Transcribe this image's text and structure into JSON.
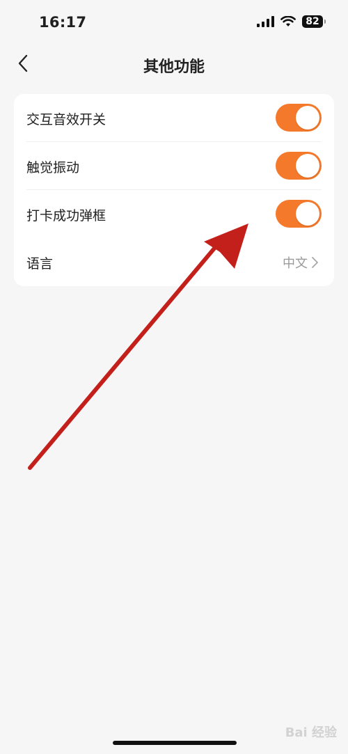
{
  "status_bar": {
    "time": "16:17",
    "battery": "82",
    "icons": [
      "signal-icon",
      "wifi-icon",
      "battery-icon"
    ]
  },
  "nav": {
    "title": "其他功能",
    "back_icon": "chevron-left-icon"
  },
  "settings": {
    "items": [
      {
        "label": "交互音效开关",
        "type": "toggle",
        "on": true
      },
      {
        "label": "触觉振动",
        "type": "toggle",
        "on": true
      },
      {
        "label": "打卡成功弹框",
        "type": "toggle",
        "on": true
      },
      {
        "label": "语言",
        "type": "link",
        "value": "中文"
      }
    ]
  },
  "colors": {
    "accent": "#f5792b",
    "background": "#f6f6f7",
    "card": "#ffffff",
    "annotation_arrow": "#c4201b"
  },
  "watermark": "Bai 经验"
}
